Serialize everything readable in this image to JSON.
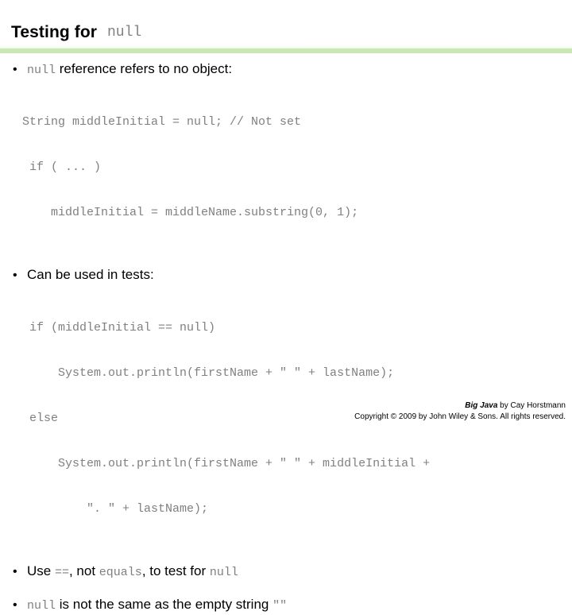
{
  "slide": {
    "title_text": "Testing for ",
    "title_mono": "null",
    "accent_color": "#c9e7b2",
    "mono_color": "#808080",
    "bullet_glyph": "•"
  },
  "bullets": [
    {
      "mono_lead": "null",
      "text": " reference refers to no object:"
    },
    {
      "mono_lead": "",
      "text": "Can be used in tests:"
    }
  ],
  "code_blocks": {
    "first": [
      "String middleInitial = null; // Not set",
      " if ( ... )",
      "    middleInitial = middleName.substring(0, 1);"
    ],
    "second": [
      "if (middleInitial == null)",
      "    System.out.println(firstName + \" \" + lastName);",
      "else",
      "    System.out.println(firstName + \" \" + middleInitial +",
      "        \". \" + lastName);"
    ]
  },
  "bullet3": {
    "part1": "Use ",
    "mono1": "==",
    "part2": ", not ",
    "mono2": "equals",
    "part3": ", to test for ",
    "mono3": "null"
  },
  "bullet4": {
    "mono1": "null",
    "part1": " is not the same as the empty string ",
    "mono2": "\"\""
  },
  "footer": {
    "book": "Big Java",
    "byline": " by Cay Horstmann",
    "copyright": "Copyright © 2009 by John Wiley & Sons.  All rights reserved."
  }
}
